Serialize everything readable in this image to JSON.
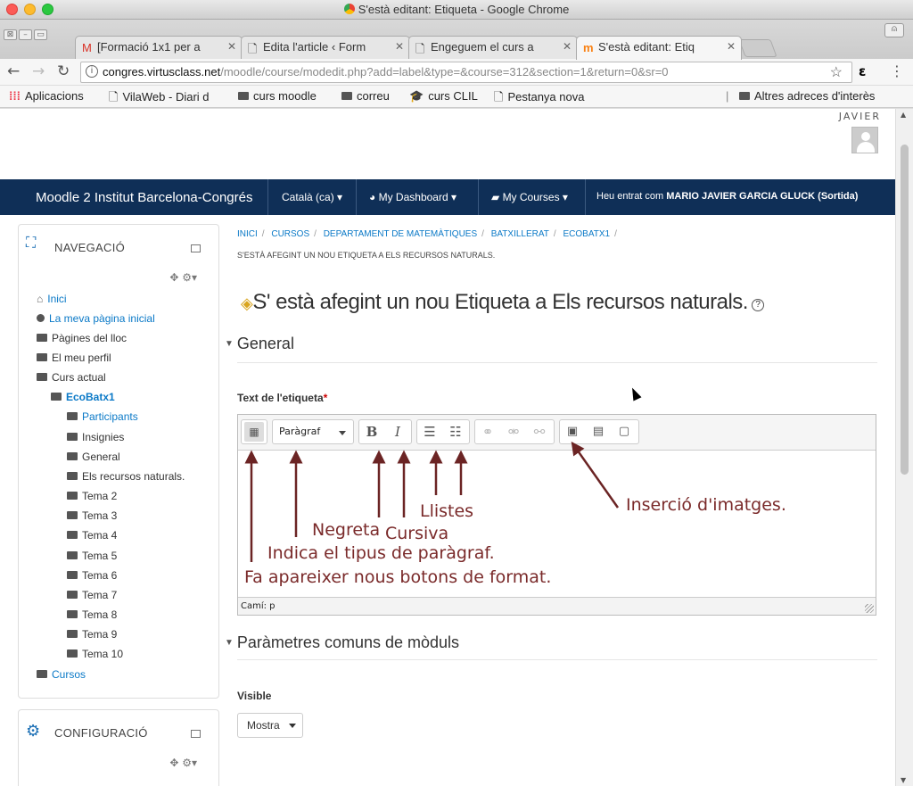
{
  "window": {
    "title": "S'està editant: Etiqueta - Google Chrome"
  },
  "tabs": [
    {
      "label": "[Formació 1x1 per a",
      "icon": "gmail-icon"
    },
    {
      "label": "Edita l'article ‹ Form",
      "icon": "page-icon"
    },
    {
      "label": "Engeguem el curs a",
      "icon": "page-icon"
    },
    {
      "label": "S'està editant: Etiq",
      "icon": "moodle-icon"
    }
  ],
  "address": {
    "host": "congres.virtusclass.net",
    "path": "/moodle/course/modedit.php?add=label&type=&course=312&section=1&return=0&sr=0"
  },
  "bookmarks": [
    "Aplicacions",
    "VilaWeb - Diari d",
    "curs moodle",
    "correu",
    "curs CLIL",
    "Pestanya nova",
    "Altres adreces d'interès"
  ],
  "user_short": "JAVIER",
  "navbar": {
    "brand": "Moodle 2 Institut Barcelona-Congrés",
    "lang": "Català (ca)",
    "dashboard": "My Dashboard",
    "courses": "My Courses",
    "logged_prefix": "Heu entrat com",
    "logged_user": "MARIO JAVIER GARCIA GLUCK",
    "logout": "(Sortida)"
  },
  "nav_block": {
    "title": "NAVEGACIÓ",
    "items": [
      "Inici",
      "La meva pàgina inicial",
      "Pàgines del lloc",
      "El meu perfil",
      "Curs actual",
      "EcoBatx1",
      "Participants",
      "Insignies",
      "General",
      "Els recursos naturals.",
      "Tema 2",
      "Tema 3",
      "Tema 4",
      "Tema 5",
      "Tema 6",
      "Tema 7",
      "Tema 8",
      "Tema 9",
      "Tema 10",
      "Cursos"
    ]
  },
  "config_block": {
    "title": "CONFIGURACIÓ"
  },
  "breadcrumb": [
    "INICI",
    "CURSOS",
    "DEPARTAMENT DE MATEMÀTIQUES",
    "BATXILLERAT",
    "ECOBATX1"
  ],
  "breadcrumb_current": "S'ESTÀ AFEGINT UN NOU ETIQUETA A ELS RECURSOS NATURALS.",
  "heading": "S' està afegint un nou Etiqueta a Els recursos naturals.",
  "section_general": "General",
  "field_label": "Text de l'etiqueta",
  "editor": {
    "paragraph": "Paràgraf",
    "status": "Camí: p"
  },
  "annotations": {
    "negreta": "Negreta",
    "cursiva": "Cursiva",
    "llistes": "Llistes",
    "imatges": "Inserció d'imatges.",
    "paragraf": "Indica el tipus de paràgraf.",
    "format": "Fa apareixer nous botons de format."
  },
  "section_common": "Paràmetres comuns de mòduls",
  "visible_label": "Visible",
  "visible_value": "Mostra",
  "colors": {
    "navbar": "#0f2f57",
    "link": "#0a79c7",
    "annotation": "#7a2a2a"
  }
}
